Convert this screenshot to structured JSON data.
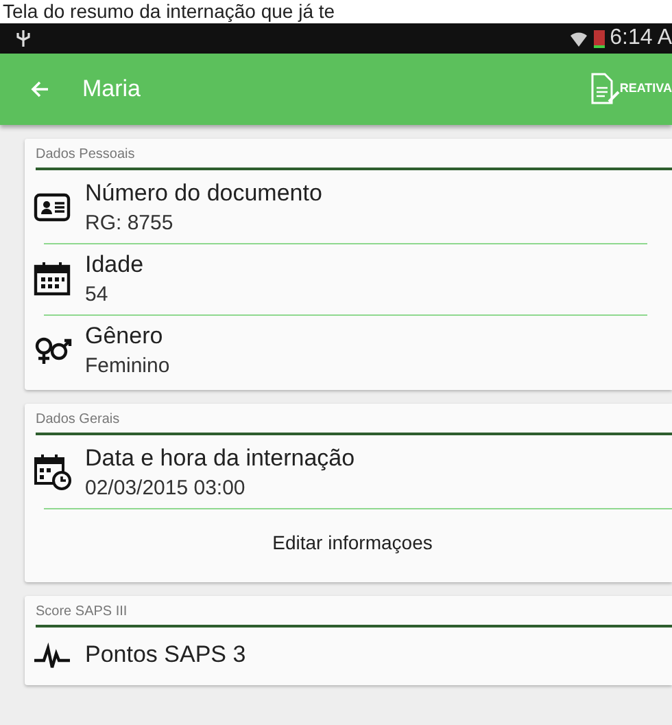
{
  "caption": "Tela do resumo da internação que já te",
  "status_bar": {
    "time": "6:14 A"
  },
  "app_bar": {
    "title": "Maria",
    "action": "REATIVA"
  },
  "sections": [
    {
      "title": "Dados Pessoais",
      "items": [
        {
          "kind": "id-card",
          "label": "Número do documento",
          "value": "RG: 8755"
        },
        {
          "kind": "calendar",
          "label": "Idade",
          "value": "54"
        },
        {
          "kind": "gender",
          "label": "Gênero",
          "value": "Feminino"
        }
      ]
    },
    {
      "title": "Dados Gerais",
      "items": [
        {
          "kind": "calendar-clock",
          "label": "Data e hora da internação",
          "value": "02/03/2015 03:00"
        }
      ],
      "button": "Editar informaçoes"
    },
    {
      "title": "Score SAPS III",
      "items": [
        {
          "kind": "heartbeat",
          "label": "Pontos SAPS 3"
        }
      ]
    }
  ]
}
